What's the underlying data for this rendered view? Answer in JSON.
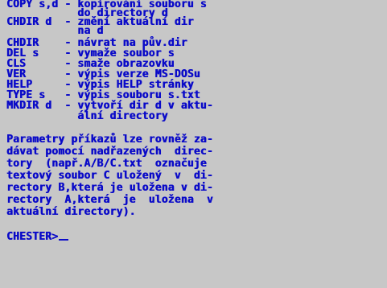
{
  "terminal": {
    "commands": [
      "COPY s,d - kopírování souboru s",
      "           do directory d",
      "CHDIR d  - změní aktuální dir",
      "           na d",
      "CHDIR    - návrat na pův.dir",
      "DEL s    - vymaže soubor s",
      "CLS      - smaže obrazovku",
      "VER      - výpis verze MS-DOSu",
      "HELP     - výpis HELP stránky",
      "TYPE s   - výpis souboru s.txt",
      "MKDIR d  - vytvoří dir d v aktu-",
      "           ální directory"
    ],
    "paragraph": [
      "Parametry příkazů lze rovněž za-",
      "dávat pomocí nadřazených  direc-",
      "tory  (např.A/B/C.txt  označuje",
      "textový soubor C uložený  v  di-",
      "rectory B,která je uložena v di-",
      "rectory  A,která  je  uložena  v",
      "aktuální directory)."
    ],
    "prompt": "CHESTER>"
  },
  "colors": {
    "background": "#c7c7c7",
    "text": "#0a0ac8"
  }
}
